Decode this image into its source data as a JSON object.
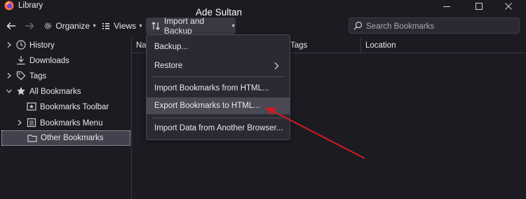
{
  "window": {
    "title": "Library",
    "overlay_name": "Ade Sultan"
  },
  "toolbar": {
    "organize_label": "Organize",
    "views_label": "Views",
    "import_backup_label": "Import and Backup",
    "search_placeholder": "Search Bookmarks"
  },
  "sidebar": {
    "items": [
      {
        "label": "History"
      },
      {
        "label": "Downloads"
      },
      {
        "label": "Tags"
      },
      {
        "label": "All Bookmarks"
      },
      {
        "label": "Bookmarks Toolbar"
      },
      {
        "label": "Bookmarks Menu"
      },
      {
        "label": "Other Bookmarks"
      }
    ]
  },
  "columns": {
    "name": "Nar",
    "tags": "Tags",
    "location": "Location"
  },
  "menu": {
    "items": [
      {
        "label": "Backup..."
      },
      {
        "label": "Restore"
      },
      {
        "label": "Import Bookmarks from HTML..."
      },
      {
        "label": "Export Bookmarks to HTML..."
      },
      {
        "label": "Import Data from Another Browser..."
      }
    ]
  },
  "colors": {
    "background": "#1c1b22",
    "menu_background": "#2b2a33",
    "highlight": "#4a4953",
    "arrow": "#d11c22"
  }
}
